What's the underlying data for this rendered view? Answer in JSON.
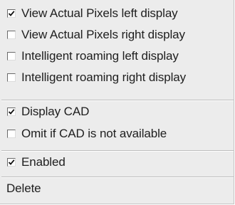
{
  "menu": {
    "items": [
      {
        "label": "View Actual Pixels left display",
        "checked": true
      },
      {
        "label": "View Actual Pixels right display",
        "checked": false
      },
      {
        "label": "Intelligent roaming left display",
        "checked": false
      },
      {
        "label": "Intelligent roaming right display",
        "checked": false
      },
      {
        "label": "Display CAD",
        "checked": true
      },
      {
        "label": "Omit if CAD is not available",
        "checked": false
      },
      {
        "label": "Enabled",
        "checked": true
      },
      {
        "label": "Delete"
      }
    ]
  }
}
